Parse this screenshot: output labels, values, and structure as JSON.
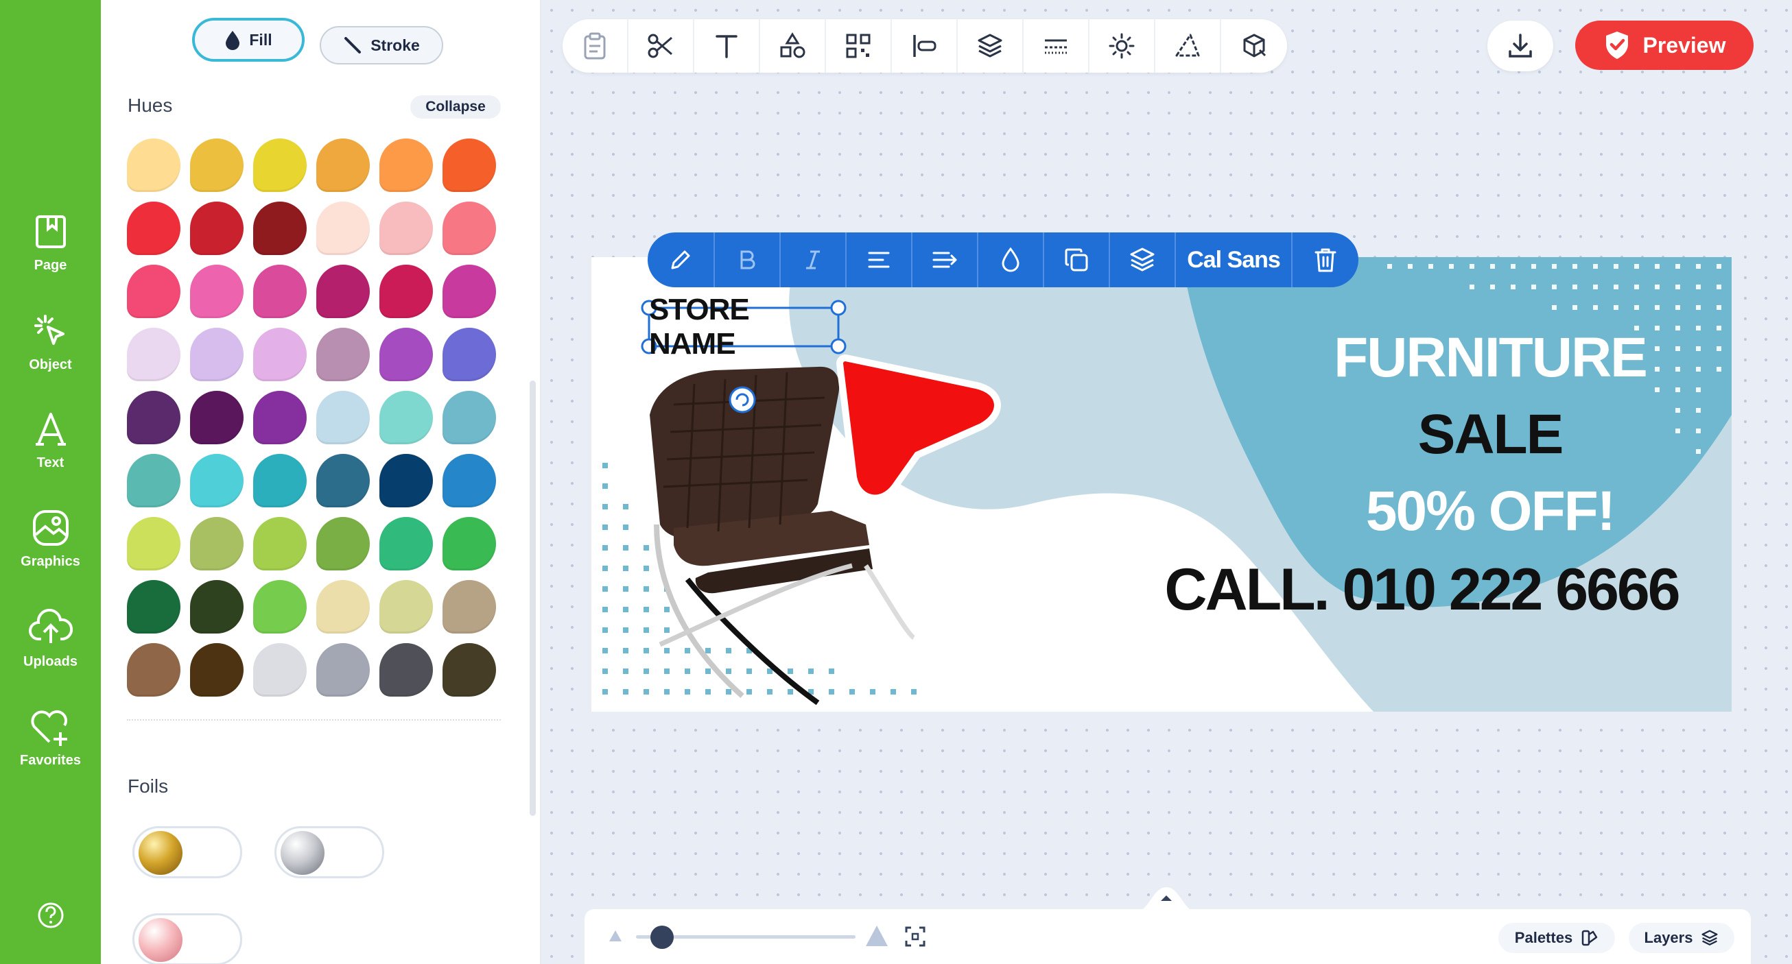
{
  "rail": {
    "items": [
      {
        "label": "Page",
        "icon": "page-icon"
      },
      {
        "label": "Object",
        "icon": "object-icon"
      },
      {
        "label": "Text",
        "icon": "text-icon"
      },
      {
        "label": "Graphics",
        "icon": "graphics-icon"
      },
      {
        "label": "Uploads",
        "icon": "uploads-icon"
      },
      {
        "label": "Favorites",
        "icon": "favorites-icon"
      }
    ],
    "help_icon": "help-icon",
    "color": "#5dbb33"
  },
  "panel": {
    "fill_label": "Fill",
    "stroke_label": "Stroke",
    "hues_title": "Hues",
    "collapse_label": "Collapse",
    "foils_title": "Foils",
    "hues": [
      "#fedc92",
      "#ecc03e",
      "#e8d530",
      "#eea83d",
      "#fd9a48",
      "#f5602a",
      "#ee2f3b",
      "#c9212e",
      "#8f1b1f",
      "#fde0d6",
      "#f8bcbe",
      "#f77785",
      "#f24a74",
      "#ee63ae",
      "#db4b9c",
      "#b4206b",
      "#cc1c58",
      "#c93a9f",
      "#ead7f0",
      "#d6bded",
      "#e4b0e8",
      "#b98fb1",
      "#a54dc0",
      "#6d6bd6",
      "#5a2a6c",
      "#5a175c",
      "#85309e",
      "#c0dbea",
      "#7fd8cf",
      "#6fb9ca",
      "#5ab9b0",
      "#4fcfd8",
      "#2cafbd",
      "#2d6d8c",
      "#063f6d",
      "#2587c9",
      "#cce05b",
      "#a8c062",
      "#a3cf4c",
      "#7aaf45",
      "#30bb7d",
      "#3aba53",
      "#196c3c",
      "#2f421f",
      "#76cc4d",
      "#ecdeaa",
      "#d5d794",
      "#b6a284",
      "#8f6647",
      "#4e3313",
      "#dcdde3",
      "#a3a6b3",
      "#505058",
      "#453d26"
    ],
    "foils": [
      "gold-foil",
      "silver-foil",
      "rose-gold-foil"
    ]
  },
  "toolbar": {
    "tools": [
      "clipboard-icon",
      "scissors-icon",
      "text-tool-icon",
      "shapes-icon",
      "qr-code-icon",
      "align-icon",
      "layers-icon",
      "spacing-icon",
      "brightness-icon",
      "triangle-icon",
      "box-icon"
    ],
    "download_icon": "download-icon",
    "preview_label": "Preview",
    "preview_icon": "shield-check-icon",
    "accent": "#f03a3a"
  },
  "float_toolbar": {
    "tools": [
      "pencil-icon",
      "bold-icon",
      "italic-icon",
      "align-left-icon",
      "text-direction-icon",
      "color-drop-icon",
      "duplicate-icon",
      "layers-icon"
    ],
    "font_name": "Cal Sans",
    "delete_icon": "trash-icon",
    "color": "#1f6fd6"
  },
  "design": {
    "store_name": "STORE NAME",
    "headline_1": "FURNITURE",
    "headline_2": "SALE",
    "headline_3": "50% OFF!",
    "phone": "CALL. 010 222 6666",
    "accent_blue": "#6fb8cf",
    "arrow_color": "#f20f10"
  },
  "bottom": {
    "zoom_level": 0.12,
    "palettes_label": "Palettes",
    "layers_label": "Layers"
  }
}
